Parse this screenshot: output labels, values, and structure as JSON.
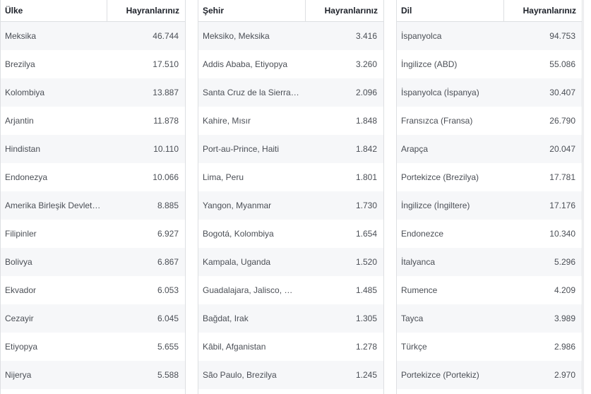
{
  "tables": [
    {
      "header": {
        "label": "Ülke",
        "value_label": "Hayranlarınız"
      },
      "rows": [
        {
          "label": "Meksika",
          "value": "46.744"
        },
        {
          "label": "Brezilya",
          "value": "17.510"
        },
        {
          "label": "Kolombiya",
          "value": "13.887"
        },
        {
          "label": "Arjantin",
          "value": "11.878"
        },
        {
          "label": "Hindistan",
          "value": "10.110"
        },
        {
          "label": "Endonezya",
          "value": "10.066"
        },
        {
          "label": "Amerika Birleşik Devlet…",
          "value": "8.885"
        },
        {
          "label": "Filipinler",
          "value": "6.927"
        },
        {
          "label": "Bolivya",
          "value": "6.867"
        },
        {
          "label": "Ekvador",
          "value": "6.053"
        },
        {
          "label": "Cezayir",
          "value": "6.045"
        },
        {
          "label": "Etiyopya",
          "value": "5.655"
        },
        {
          "label": "Nijerya",
          "value": "5.588"
        }
      ]
    },
    {
      "header": {
        "label": "Şehir",
        "value_label": "Hayranlarınız"
      },
      "rows": [
        {
          "label": "Meksiko, Meksika",
          "value": "3.416"
        },
        {
          "label": "Addis Ababa, Etiyopya",
          "value": "3.260"
        },
        {
          "label": "Santa Cruz de la Sierra…",
          "value": "2.096"
        },
        {
          "label": "Kahire, Mısır",
          "value": "1.848"
        },
        {
          "label": "Port-au-Prince, Haiti",
          "value": "1.842"
        },
        {
          "label": "Lima, Peru",
          "value": "1.801"
        },
        {
          "label": "Yangon, Myanmar",
          "value": "1.730"
        },
        {
          "label": "Bogotá, Kolombiya",
          "value": "1.654"
        },
        {
          "label": "Kampala, Uganda",
          "value": "1.520"
        },
        {
          "label": "Guadalajara, Jalisco, …",
          "value": "1.485"
        },
        {
          "label": "Bağdat, Irak",
          "value": "1.305"
        },
        {
          "label": "Kâbil, Afganistan",
          "value": "1.278"
        },
        {
          "label": "São Paulo, Brezilya",
          "value": "1.245"
        }
      ]
    },
    {
      "header": {
        "label": "Dil",
        "value_label": "Hayranlarınız"
      },
      "rows": [
        {
          "label": "İspanyolca",
          "value": "94.753"
        },
        {
          "label": "İngilizce (ABD)",
          "value": "55.086"
        },
        {
          "label": "İspanyolca (İspanya)",
          "value": "30.407"
        },
        {
          "label": "Fransızca (Fransa)",
          "value": "26.790"
        },
        {
          "label": "Arapça",
          "value": "20.047"
        },
        {
          "label": "Portekizce (Brezilya)",
          "value": "17.781"
        },
        {
          "label": "İngilizce (İngiltere)",
          "value": "17.176"
        },
        {
          "label": "Endonezce",
          "value": "10.340"
        },
        {
          "label": "İtalyanca",
          "value": "5.296"
        },
        {
          "label": "Rumence",
          "value": "4.209"
        },
        {
          "label": "Tayca",
          "value": "3.989"
        },
        {
          "label": "Türkçe",
          "value": "2.986"
        },
        {
          "label": "Portekizce (Portekiz)",
          "value": "2.970"
        }
      ]
    }
  ]
}
